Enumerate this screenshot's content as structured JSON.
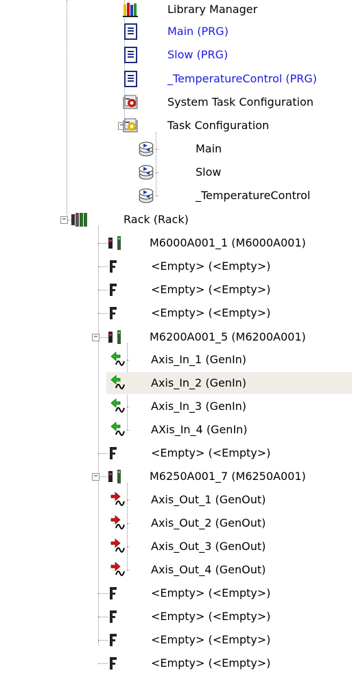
{
  "tree": {
    "items": [
      {
        "label": "Library Manager",
        "icon": "library-icon"
      },
      {
        "label": "Main (PRG)",
        "icon": "program-document-icon"
      },
      {
        "label": "Slow (PRG)",
        "icon": "program-document-icon"
      },
      {
        "label": "_TemperatureControl (PRG)",
        "icon": "program-document-icon"
      },
      {
        "label": "System Task Configuration",
        "icon": "system-task-config-icon"
      },
      {
        "label": "Task Configuration",
        "icon": "task-config-icon",
        "expander": "−"
      },
      {
        "label": "Main",
        "icon": "task-icon"
      },
      {
        "label": "Slow",
        "icon": "task-icon"
      },
      {
        "label": "_TemperatureControl",
        "icon": "task-icon"
      },
      {
        "label": "Rack (Rack)",
        "icon": "rack-icon",
        "expander": "−"
      },
      {
        "label": "M6000A001_1 (M6000A001)",
        "icon": "module-icon"
      },
      {
        "label": "<Empty> (<Empty>)",
        "icon": "empty-slot-icon"
      },
      {
        "label": "<Empty> (<Empty>)",
        "icon": "empty-slot-icon"
      },
      {
        "label": "<Empty> (<Empty>)",
        "icon": "empty-slot-icon"
      },
      {
        "label": "M6200A001_5 (M6200A001)",
        "icon": "module-icon",
        "expander": "−"
      },
      {
        "label": "Axis_In_1 (GenIn)",
        "icon": "generic-input-icon"
      },
      {
        "label": "Axis_In_2 (GenIn)",
        "icon": "generic-input-icon"
      },
      {
        "label": "Axis_In_3 (GenIn)",
        "icon": "generic-input-icon"
      },
      {
        "label": "AXis_In_4 (GenIn)",
        "icon": "generic-input-icon"
      },
      {
        "label": "<Empty> (<Empty>)",
        "icon": "empty-slot-icon"
      },
      {
        "label": "M6250A001_7 (M6250A001)",
        "icon": "module-icon",
        "expander": "−"
      },
      {
        "label": "Axis_Out_1 (GenOut)",
        "icon": "generic-output-icon"
      },
      {
        "label": "Axis_Out_2 (GenOut)",
        "icon": "generic-output-icon"
      },
      {
        "label": "Axis_Out_3 (GenOut)",
        "icon": "generic-output-icon"
      },
      {
        "label": "Axis_Out_4 (GenOut)",
        "icon": "generic-output-icon"
      },
      {
        "label": "<Empty> (<Empty>)",
        "icon": "empty-slot-icon"
      },
      {
        "label": "<Empty> (<Empty>)",
        "icon": "empty-slot-icon"
      },
      {
        "label": "<Empty> (<Empty>)",
        "icon": "empty-slot-icon"
      },
      {
        "label": "<Empty> (<Empty>)",
        "icon": "empty-slot-icon"
      }
    ],
    "selected_label": "Axis_In_2 (GenIn)"
  },
  "colors": {
    "link_text": "#1a1adf",
    "selection_bg": "#efede6",
    "connector": "#8a8a8a"
  }
}
